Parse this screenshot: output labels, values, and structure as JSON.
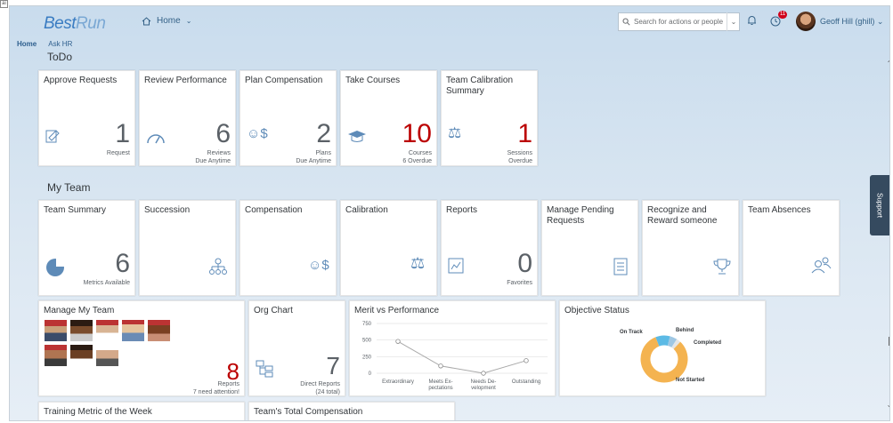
{
  "header": {
    "logo_prefix": "Best",
    "logo_suffix": "Run",
    "home_label": "Home",
    "search_placeholder": "Search for actions or people",
    "notification_count": "11",
    "user_name": "Geoff Hill (ghill)"
  },
  "sub_nav": {
    "home": "Home",
    "ask_hr": "Ask HR"
  },
  "sections": {
    "todo": "ToDo",
    "my_team": "My Team"
  },
  "todo_tiles": [
    {
      "title": "Approve Requests",
      "value": "1",
      "footer1": "Request",
      "footer2": "",
      "icon": "approve-icon"
    },
    {
      "title": "Review Performance",
      "value": "6",
      "footer1": "Reviews",
      "footer2": "Due Anytime",
      "icon": "gauge-icon"
    },
    {
      "title": "Plan Compensation",
      "value": "2",
      "footer1": "Plans",
      "footer2": "Due Anytime",
      "icon": "compensation-icon"
    },
    {
      "title": "Take Courses",
      "value": "10",
      "footer1": "Courses",
      "footer2": "6 Overdue",
      "icon": "graduation-cap-icon"
    },
    {
      "title": "Team Calibration Summary",
      "value": "1",
      "footer1": "Sessions",
      "footer2": "Overdue",
      "icon": "scales-icon"
    }
  ],
  "team_tiles": [
    {
      "title": "Team Summary",
      "value": "6",
      "footer": "Metrics Available",
      "icon": "pie-chart-icon"
    },
    {
      "title": "Succession",
      "icon": "org-hierarchy-icon"
    },
    {
      "title": "Compensation",
      "icon": "compensation-icon"
    },
    {
      "title": "Calibration",
      "icon": "scales-icon"
    },
    {
      "title": "Reports",
      "value": "0",
      "footer": "Favorites",
      "icon": "report-icon"
    },
    {
      "title": "Manage Pending Requests",
      "icon": "checklist-icon"
    },
    {
      "title": "Recognize and Reward someone",
      "icon": "trophy-icon"
    },
    {
      "title": "Team Absences",
      "icon": "people-icon"
    }
  ],
  "manage_team": {
    "title": "Manage My Team",
    "value": "8",
    "footer1": "Reports",
    "footer2": "7 need attention!"
  },
  "org_chart": {
    "title": "Org Chart",
    "value": "7",
    "footer1": "Direct Reports",
    "footer2": "(24 total)"
  },
  "merit_chart": {
    "title": "Merit vs Performance"
  },
  "objective_chart": {
    "title": "Objective Status"
  },
  "bottom_tiles": {
    "training": "Training Metric of the Week",
    "compensation": "Team's Total Compensation"
  },
  "support_label": "Support",
  "chart_data": [
    {
      "type": "line",
      "title": "Merit vs Performance",
      "categories": [
        "Extraordinary",
        "Meets Ex-\npectations",
        "Needs De-\nvelopment",
        "Outstanding"
      ],
      "values": [
        480,
        110,
        0,
        190
      ],
      "ylim": [
        0,
        750
      ],
      "yticks": [
        "750",
        "500",
        "250",
        "0"
      ],
      "grid": true,
      "color": "#a9a9a9"
    },
    {
      "type": "pie",
      "title": "Objective Status",
      "labels": [
        "On Track",
        "Behind",
        "Completed",
        "Not Started"
      ],
      "values": [
        10,
        5,
        3,
        82
      ],
      "colors": [
        "#5cbae5",
        "#9fc7e3",
        "#e5e5e5",
        "#f4b350"
      ]
    }
  ]
}
